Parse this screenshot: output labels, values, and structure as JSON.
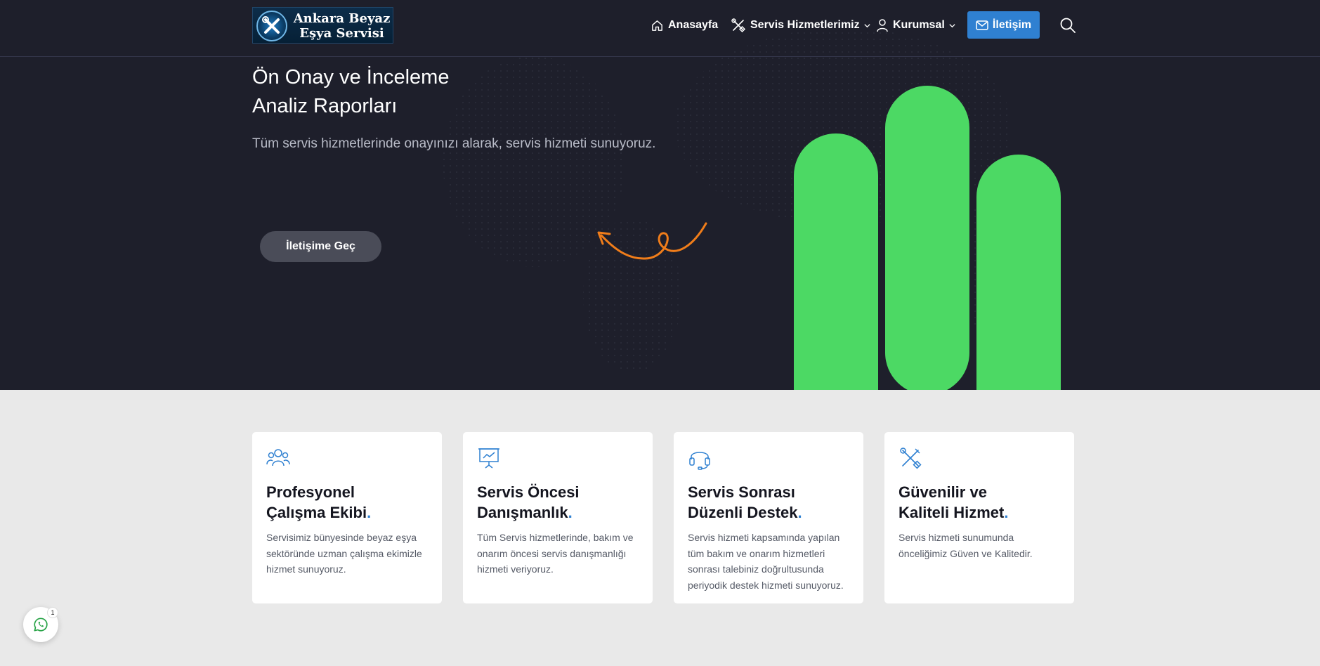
{
  "header": {
    "logo_line1": "Ankara Beyaz",
    "logo_line2": "Eşya Servisi",
    "nav": {
      "home": "Anasayfa",
      "services": "Servis Hizmetlerimiz",
      "corporate": "Kurumsal"
    },
    "contact_label": "İletişim"
  },
  "hero": {
    "title_line1": "Ön Onay ve İnceleme",
    "title_line2": "Analiz Raporları",
    "subtitle": "Tüm servis hizmetlerinde onayınızı alarak, servis hizmeti sunuyoruz.",
    "cta_label": "İletişime Geç"
  },
  "features": [
    {
      "icon": "team-icon",
      "title_line1": "Profesyonel",
      "title_line2": "Çalışma Ekibi",
      "description": "Servisimiz bünyesinde beyaz eşya sektöründe uzman çalışma ekimizle hizmet sunuyoruz."
    },
    {
      "icon": "presentation-icon",
      "title_line1": "Servis Öncesi",
      "title_line2": "Danışmanlık",
      "description": "Tüm Servis hizmetlerinde, bakım ve onarım öncesi servis danışmanlığı hizmeti veriyoruz."
    },
    {
      "icon": "headset-icon",
      "title_line1": "Servis Sonrası",
      "title_line2": "Düzenli Destek",
      "description": "Servis hizmeti kapsamında yapılan tüm bakım ve onarım hizmetleri sonrası talebiniz doğrultusunda periyodik destek hizmeti sunuyoruz."
    },
    {
      "icon": "tools-icon",
      "title_line1": "Güvenilir ve",
      "title_line2": "Kaliteli Hizmet",
      "description": "Servis hizmeti sunumunda önceliğimiz Güven ve Kalitedir."
    }
  ],
  "whatsapp": {
    "badge_count": "1"
  },
  "colors": {
    "hero_bg": "#1e1f2b",
    "accent_blue": "#2f80d1",
    "bar_green": "#4cd964",
    "squiggle_orange": "#f07d1a"
  }
}
